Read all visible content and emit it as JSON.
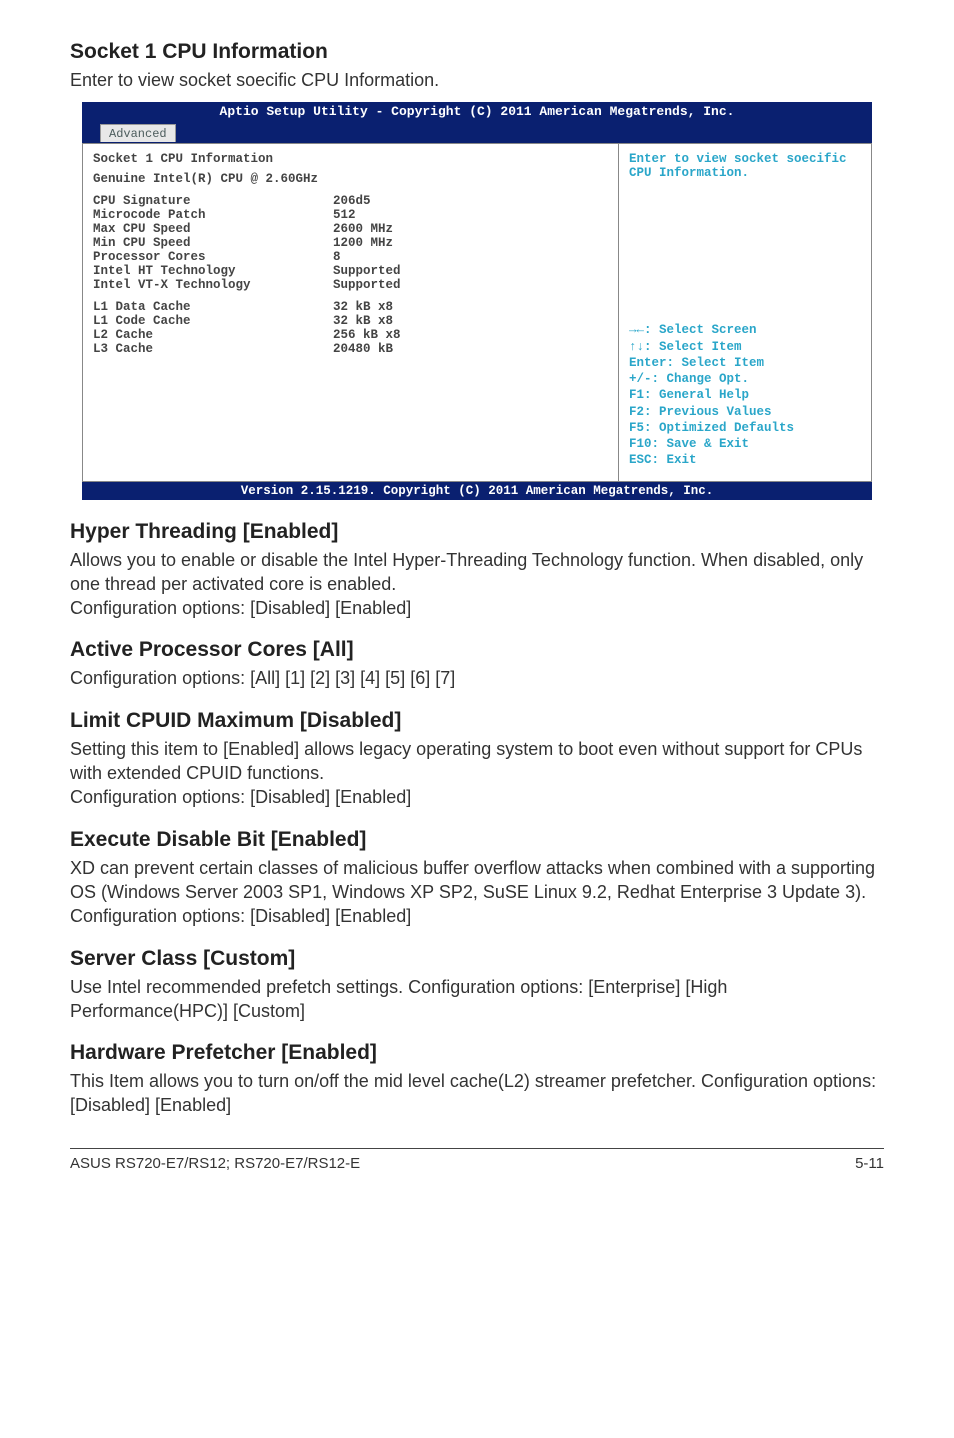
{
  "headings": {
    "socket1": "Socket 1 CPU Information",
    "socket1_desc": "Enter to view socket soecific CPU Information.",
    "hyper": "Hyper Threading [Enabled]",
    "hyper_desc": "Allows you to enable or disable the Intel Hyper-Threading Technology function. When disabled, only one thread per activated core is enabled.\nConfiguration options: [Disabled] [Enabled]",
    "active": "Active Processor Cores [All]",
    "active_desc": "Configuration options: [All] [1] [2] [3] [4] [5] [6] [7]",
    "limit": "Limit CPUID Maximum [Disabled]",
    "limit_desc": "Setting this item to [Enabled] allows legacy operating system to boot even without support for CPUs with extended CPUID functions.\nConfiguration options: [Disabled] [Enabled]",
    "execute": "Execute Disable Bit [Enabled]",
    "execute_desc": "XD can prevent certain classes of malicious buffer overflow attacks when combined with a supporting OS (Windows Server 2003 SP1, Windows XP SP2, SuSE Linux 9.2, Redhat Enterprise 3 Update 3). Configuration options: [Disabled] [Enabled]",
    "server": "Server Class [Custom]",
    "server_desc": "Use Intel recommended prefetch settings. Configuration options: [Enterprise] [High Performance(HPC)] [Custom]",
    "hw": "Hardware Prefetcher [Enabled]",
    "hw_desc": "This Item allows you to turn on/off the mid level cache(L2) streamer prefetcher. Configuration options: [Disabled] [Enabled]"
  },
  "bios": {
    "header": "Aptio Setup Utility - Copyright (C) 2011 American Megatrends, Inc.",
    "tab": "Advanced",
    "left": {
      "title1": "Socket 1 CPU Information",
      "title2": "Genuine Intel(R) CPU @ 2.60GHz",
      "rows": [
        {
          "l": "CPU Signature",
          "r": "206d5"
        },
        {
          "l": "Microcode Patch",
          "r": "512"
        },
        {
          "l": "Max CPU Speed",
          "r": "2600 MHz"
        },
        {
          "l": "Min CPU Speed",
          "r": "1200 MHz"
        },
        {
          "l": "Processor Cores",
          "r": "8"
        },
        {
          "l": "Intel HT Technology",
          "r": "Supported"
        },
        {
          "l": "Intel VT-X Technology",
          "r": "Supported"
        }
      ],
      "rows2": [
        {
          "l": "L1 Data Cache",
          "r": "32 kB x8"
        },
        {
          "l": "L1 Code Cache",
          "r": "32 kB x8"
        },
        {
          "l": "L2 Cache",
          "r": "256 kB x8"
        },
        {
          "l": "L3 Cache",
          "r": "20480 kB"
        }
      ]
    },
    "right": {
      "help": "Enter to view socket soecific CPU Information.",
      "nav": [
        "→←: Select Screen",
        "↑↓:  Select Item",
        "Enter: Select Item",
        "+/-: Change Opt.",
        "F1: General Help",
        "F2: Previous Values",
        "F5: Optimized Defaults",
        "F10: Save & Exit",
        "ESC: Exit"
      ]
    },
    "footer": "Version 2.15.1219. Copyright (C) 2011 American Megatrends, Inc."
  },
  "footer": {
    "model": "ASUS RS720-E7/RS12; RS720-E7/RS12-E",
    "page": "5-11"
  }
}
